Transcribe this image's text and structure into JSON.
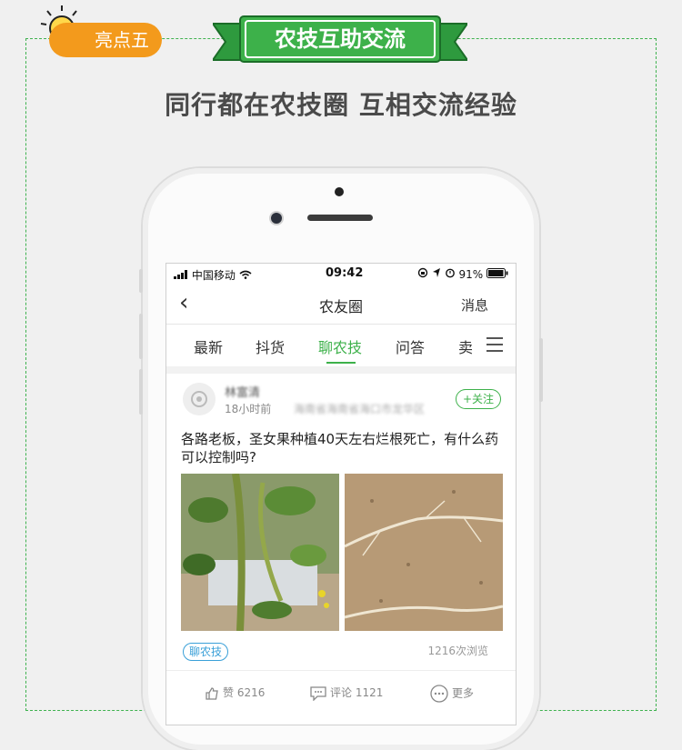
{
  "banner": {
    "badge_label": "亮点五",
    "ribbon_title": "农技互助交流",
    "headline": "同行都在农技圈 互相交流经验",
    "colors": {
      "accent": "#3db14a",
      "badge": "#f39a1c"
    }
  },
  "status_bar": {
    "carrier": "中国移动",
    "time": "09:42",
    "battery": "91%"
  },
  "nav": {
    "title": "农友圈",
    "messages": "消息"
  },
  "tabs": [
    {
      "label": "最新"
    },
    {
      "label": "抖货"
    },
    {
      "label": "聊农技"
    },
    {
      "label": "问答"
    },
    {
      "label": "卖"
    }
  ],
  "active_tab": "聊农技",
  "post": {
    "author": "林富清",
    "time": "18小时前",
    "location": "海南省海南省海口市龙华区",
    "follow_label": "+关注",
    "text": "各路老板，圣女果种植40天左右烂根死亡，有什么药可以控制吗?",
    "tag": "聊农技",
    "views": "1216次浏览",
    "likes_label": "赞 6216",
    "comments_label": "评论 1121",
    "more_label": "更多"
  }
}
